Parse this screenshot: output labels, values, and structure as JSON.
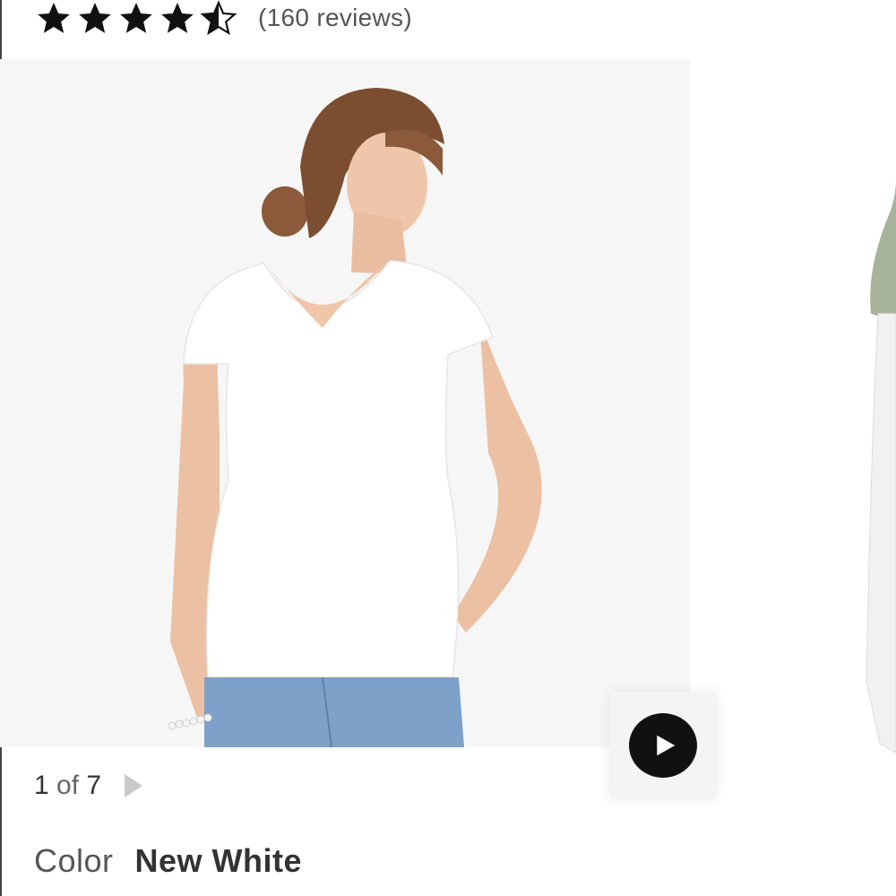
{
  "rating": {
    "stars": [
      {
        "icon": "star-full-icon"
      },
      {
        "icon": "star-full-icon"
      },
      {
        "icon": "star-full-icon"
      },
      {
        "icon": "star-full-icon"
      },
      {
        "icon": "star-half-icon"
      }
    ],
    "value": 4.5,
    "reviews_label": "(160 reviews)"
  },
  "gallery": {
    "counter_current": "1",
    "counter_of": "of",
    "counter_total": "7",
    "video_icon": "play-icon",
    "next_icon": "chevron-right-icon"
  },
  "color": {
    "label": "Color",
    "value": "New White"
  },
  "colors": {
    "star": "#111111",
    "image_bg": "#f6f6f7",
    "play_button": "#111111"
  }
}
